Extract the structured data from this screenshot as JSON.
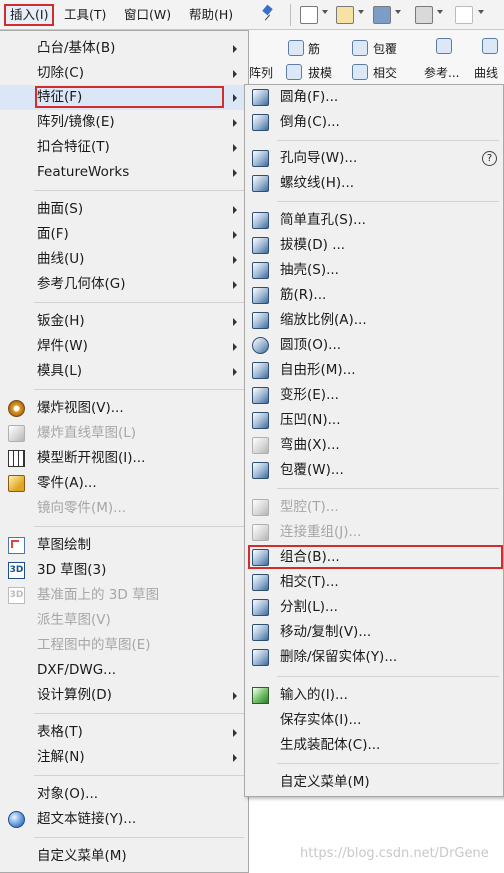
{
  "menubar": {
    "items": [
      "插入(I)",
      "工具(T)",
      "窗口(W)",
      "帮助(H)"
    ]
  },
  "ribbon": {
    "labels": [
      "筋",
      "包覆",
      "阵列",
      "拔模",
      "相交",
      "参考...",
      "曲线"
    ]
  },
  "main_menu": {
    "items": [
      {
        "label": "凸台/基体(B)",
        "submenu": true,
        "disabled": false
      },
      {
        "label": "切除(C)",
        "submenu": true,
        "disabled": false
      },
      {
        "label": "特征(F)",
        "submenu": true,
        "disabled": false
      },
      {
        "label": "阵列/镜像(E)",
        "submenu": true,
        "disabled": false
      },
      {
        "label": "扣合特征(T)",
        "submenu": true,
        "disabled": false
      },
      {
        "label": "FeatureWorks",
        "submenu": true,
        "disabled": false
      },
      {
        "label": "曲面(S)",
        "submenu": true,
        "disabled": false
      },
      {
        "label": "面(F)",
        "submenu": true,
        "disabled": false
      },
      {
        "label": "曲线(U)",
        "submenu": true,
        "disabled": false
      },
      {
        "label": "参考几何体(G)",
        "submenu": true,
        "disabled": false
      },
      {
        "label": "钣金(H)",
        "submenu": true,
        "disabled": false
      },
      {
        "label": "焊件(W)",
        "submenu": true,
        "disabled": false
      },
      {
        "label": "模具(L)",
        "submenu": true,
        "disabled": false
      },
      {
        "label": "爆炸视图(V)...",
        "submenu": false,
        "disabled": false
      },
      {
        "label": "爆炸直线草图(L)",
        "submenu": false,
        "disabled": true
      },
      {
        "label": "模型断开视图(I)...",
        "submenu": false,
        "disabled": false
      },
      {
        "label": "零件(A)...",
        "submenu": false,
        "disabled": false
      },
      {
        "label": "镜向零件(M)...",
        "submenu": false,
        "disabled": true
      },
      {
        "label": "草图绘制",
        "submenu": false,
        "disabled": false
      },
      {
        "label": "3D 草图(3)",
        "submenu": false,
        "disabled": false
      },
      {
        "label": "基准面上的 3D 草图",
        "submenu": false,
        "disabled": true
      },
      {
        "label": "派生草图(V)",
        "submenu": false,
        "disabled": true
      },
      {
        "label": "工程图中的草图(E)",
        "submenu": false,
        "disabled": true
      },
      {
        "label": "DXF/DWG...",
        "submenu": false,
        "disabled": false
      },
      {
        "label": "设计算例(D)",
        "submenu": true,
        "disabled": false
      },
      {
        "label": "表格(T)",
        "submenu": true,
        "disabled": false
      },
      {
        "label": "注解(N)",
        "submenu": true,
        "disabled": false
      },
      {
        "label": "对象(O)...",
        "submenu": false,
        "disabled": false
      },
      {
        "label": "超文本链接(Y)...",
        "submenu": false,
        "disabled": false
      },
      {
        "label": "自定义菜单(M)",
        "submenu": false,
        "disabled": false
      }
    ]
  },
  "sub_menu": {
    "items": [
      {
        "label": "圆角(F)...",
        "disabled": false,
        "icon": "fillet-icon"
      },
      {
        "label": "倒角(C)...",
        "disabled": false,
        "icon": "chamfer-icon"
      },
      {
        "label": "孔向导(W)...",
        "disabled": false,
        "icon": "hole-wizard-icon"
      },
      {
        "label": "螺纹线(H)...",
        "disabled": false,
        "icon": "thread-icon"
      },
      {
        "label": "简单直孔(S)...",
        "disabled": false,
        "icon": "simple-hole-icon"
      },
      {
        "label": "拔模(D) ...",
        "disabled": false,
        "icon": "draft-icon"
      },
      {
        "label": "抽壳(S)...",
        "disabled": false,
        "icon": "shell-icon"
      },
      {
        "label": "筋(R)...",
        "disabled": false,
        "icon": "rib-icon"
      },
      {
        "label": "缩放比例(A)...",
        "disabled": false,
        "icon": "scale-icon"
      },
      {
        "label": "圆顶(O)...",
        "disabled": false,
        "icon": "dome-icon"
      },
      {
        "label": "自由形(M)...",
        "disabled": false,
        "icon": "freeform-icon"
      },
      {
        "label": "变形(E)...",
        "disabled": false,
        "icon": "deform-icon"
      },
      {
        "label": "压凹(N)...",
        "disabled": false,
        "icon": "indent-icon"
      },
      {
        "label": "弯曲(X)...",
        "disabled": false,
        "icon": "flex-icon"
      },
      {
        "label": "包覆(W)...",
        "disabled": false,
        "icon": "wrap-icon"
      },
      {
        "label": "型腔(T)...",
        "disabled": true,
        "icon": "cavity-icon"
      },
      {
        "label": "连接重组(J)...",
        "disabled": true,
        "icon": "join-icon"
      },
      {
        "label": "组合(B)...",
        "disabled": false,
        "icon": "combine-icon"
      },
      {
        "label": "相交(T)...",
        "disabled": false,
        "icon": "intersect-icon"
      },
      {
        "label": "分割(L)...",
        "disabled": false,
        "icon": "split-icon"
      },
      {
        "label": "移动/复制(V)...",
        "disabled": false,
        "icon": "move-copy-icon"
      },
      {
        "label": "删除/保留实体(Y)...",
        "disabled": false,
        "icon": "delete-body-icon"
      },
      {
        "label": "输入的(I)...",
        "disabled": false,
        "icon": "imported-icon"
      },
      {
        "label": "保存实体(I)...",
        "disabled": false,
        "icon": null
      },
      {
        "label": "生成装配体(C)...",
        "disabled": false,
        "icon": null
      },
      {
        "label": "自定义菜单(M)",
        "disabled": false,
        "icon": null
      }
    ],
    "help_glyph": "?"
  },
  "watermark": "https://blog.csdn.net/DrGene",
  "colors": {
    "highlight_box": "#d12d2d",
    "menu_bg": "#f0f0f0",
    "selected_bg": "#dbe7f6"
  }
}
